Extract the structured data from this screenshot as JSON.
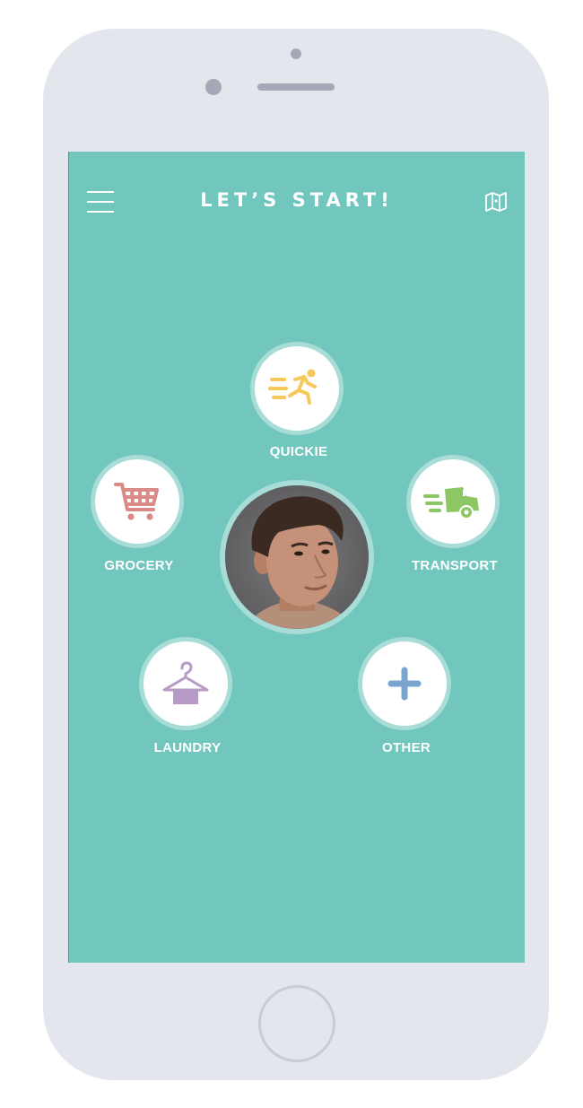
{
  "screen": {
    "title": "LET’S START!",
    "background_color": "#71c6bd"
  },
  "header": {
    "menu_icon": "hamburger-menu-icon",
    "map_icon": "map-icon"
  },
  "services": [
    {
      "label": "QUICKIE",
      "icon": "running-person-icon",
      "color": "#f7c85a"
    },
    {
      "label": "GROCERY",
      "icon": "shopping-cart-icon",
      "color": "#d98a86"
    },
    {
      "label": "TRANSPORT",
      "icon": "delivery-truck-icon",
      "color": "#8cc763"
    },
    {
      "label": "LAUNDRY",
      "icon": "clothes-hanger-icon",
      "color": "#b79bc6"
    },
    {
      "label": "OTHER",
      "icon": "plus-icon",
      "color": "#7aa5cf"
    }
  ],
  "profile": {
    "avatar": "user-avatar"
  }
}
